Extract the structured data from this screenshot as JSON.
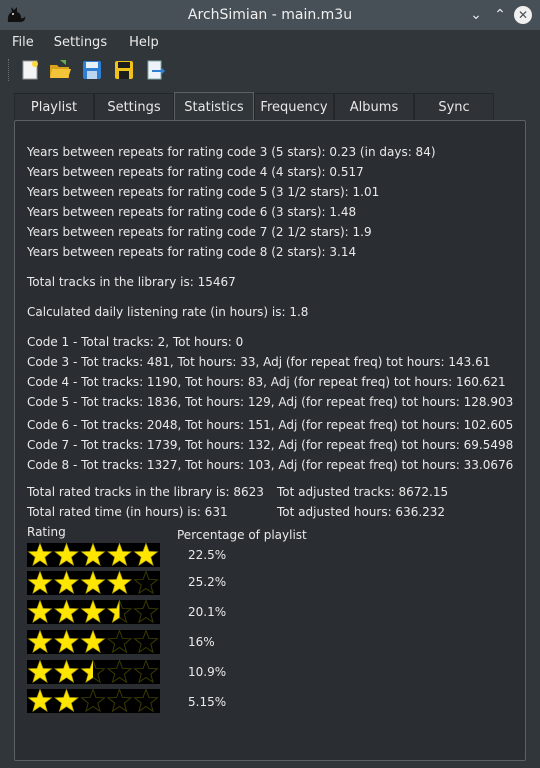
{
  "window": {
    "title": "ArchSimian - main.m3u"
  },
  "menu": {
    "items": [
      "File",
      "Settings",
      "Help"
    ]
  },
  "toolbar": {
    "icons": [
      "new-file-icon",
      "open-folder-icon",
      "save-icon",
      "save-as-icon",
      "export-icon"
    ]
  },
  "tabs": [
    "Playlist",
    "Settings",
    "Statistics",
    "Frequency",
    "Albums",
    "Sync"
  ],
  "active_tab": "Statistics",
  "stats": {
    "repeat_lines": [
      "Years between repeats for rating code 3 (5 stars): 0.23 (in days: 84)",
      "Years between repeats for rating code 4 (4 stars): 0.517",
      "Years between repeats for rating code 5 (3 1/2 stars): 1.01",
      "Years between repeats for rating code 6 (3 stars): 1.48",
      "Years between repeats for rating code 7 (2 1/2 stars): 1.9",
      "Years between repeats for rating code 8 (2 stars): 3.14"
    ],
    "total_tracks": "Total tracks in the library is: 15467",
    "daily_rate": "Calculated daily listening rate (in hours) is: 1.8",
    "code_lines": [
      "Code 1 - Total tracks: 2, Tot hours: 0",
      "Code 3 - Tot tracks: 481, Tot hours: 33, Adj (for repeat freq) tot hours: 143.61",
      "Code 4 - Tot tracks: 1190, Tot hours: 83, Adj (for repeat freq) tot hours: 160.621",
      "Code 5 - Tot tracks: 1836, Tot hours: 129, Adj (for repeat freq) tot hours: 128.903",
      "Code 6 - Tot tracks: 2048, Tot hours: 151, Adj (for repeat freq) tot hours: 102.605",
      "Code 7 - Tot tracks: 1739, Tot hours: 132, Adj (for repeat freq) tot hours: 69.5498",
      "Code 8 - Tot tracks: 1327, Tot hours: 103, Adj (for repeat freq) tot hours: 33.0676"
    ],
    "total_rated_tracks": "Total rated tracks in the library is: 8623",
    "tot_adjusted_tracks": "Tot adjusted tracks: 8672.15",
    "total_rated_time": "Total rated time (in hours) is: 631",
    "tot_adjusted_hours": "Tot adjusted hours: 636.232"
  },
  "ratings_table": {
    "rating_header": "Rating",
    "percentage_header": "Percentage of playlist",
    "rows": [
      {
        "stars": 5,
        "percent": "22.5%"
      },
      {
        "stars": 4,
        "percent": "25.2%"
      },
      {
        "stars": 3.5,
        "percent": "20.1%"
      },
      {
        "stars": 3,
        "percent": "16%"
      },
      {
        "stars": 2.5,
        "percent": "10.9%"
      },
      {
        "stars": 2,
        "percent": "5.15%"
      }
    ]
  },
  "colors": {
    "star_fill": "#ffe600",
    "star_empty": "#3a3a00",
    "background": "#2a2e32",
    "titlebar": "#475057"
  }
}
